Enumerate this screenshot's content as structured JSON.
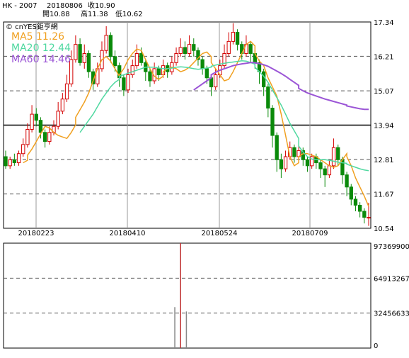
{
  "header": {
    "symbol": "HK - 2007",
    "date": "20180806",
    "close_label": "收10.90",
    "open_label": "開10.88",
    "high_label": "高11.38",
    "low_label": "低10.62"
  },
  "legend": {
    "brand": "© cnYES鉅亨網",
    "ma5": "MA5 11.26",
    "ma20": "MA20 12.44",
    "ma60": "MA60 14.46"
  },
  "colors": {
    "up": "#d40000",
    "down": "#0a8a0a",
    "ma5": "#f0a020",
    "ma20": "#4fd8a0",
    "ma60": "#9b55d6",
    "volume_up": "#c03030",
    "volume_down": "#888888"
  },
  "chart_data": [
    {
      "type": "candlestick",
      "title": "",
      "ylim": [
        10.54,
        17.34
      ],
      "y_ticks": [
        "17.34",
        "16.21",
        "15.07",
        "13.94",
        "12.81",
        "11.67",
        "10.54"
      ],
      "x_ticks": [
        "20180223",
        "20180410",
        "20180524",
        "20180709"
      ],
      "grid": true,
      "series": [
        {
          "name": "MA5",
          "values": [
            null,
            null,
            null,
            null,
            12.7,
            12.78,
            12.95,
            13.15,
            13.4,
            13.65,
            13.9,
            13.85,
            13.7,
            13.6,
            13.55,
            13.5,
            13.7,
            13.95,
            14.2,
            14.45,
            14.7,
            15.0,
            15.4,
            15.8,
            16.1,
            16.2,
            16.05,
            15.8,
            15.55,
            15.6,
            15.8,
            16.1,
            16.3,
            16.45,
            16.4,
            16.1,
            15.8,
            15.55,
            15.45,
            15.55,
            15.7,
            15.8,
            15.85,
            15.8,
            15.7,
            15.75,
            15.85,
            16.0,
            16.15,
            16.3,
            16.35,
            16.2,
            16.0,
            15.8,
            15.6,
            15.4,
            15.45,
            15.7,
            16.0,
            16.3,
            16.6,
            16.7,
            16.55,
            16.3,
            16.05,
            15.9,
            15.5,
            15.2,
            14.9,
            14.3,
            13.6,
            12.9,
            12.6,
            12.7,
            12.9,
            13.0,
            13.0,
            12.95,
            12.9,
            12.8,
            12.7,
            12.6,
            12.55,
            12.6,
            12.8,
            13.0,
            12.9,
            12.6,
            12.2,
            11.9,
            11.6,
            11.26
          ]
        },
        {
          "name": "MA20",
          "values": [
            null,
            null,
            null,
            null,
            null,
            null,
            null,
            null,
            null,
            null,
            null,
            null,
            null,
            null,
            null,
            null,
            null,
            null,
            null,
            13.7,
            13.9,
            14.1,
            14.3,
            14.55,
            14.8,
            15.0,
            15.2,
            15.35,
            15.45,
            15.55,
            15.6,
            15.65,
            15.7,
            15.75,
            15.8,
            15.85,
            15.85,
            15.85,
            15.82,
            15.8,
            15.8,
            15.8,
            15.82,
            15.85,
            15.86,
            15.85,
            15.83,
            15.8,
            15.78,
            15.8,
            15.82,
            15.85,
            15.88,
            15.92,
            15.95,
            15.98,
            16.0,
            16.02,
            16.04,
            16.06,
            16.05,
            16.0,
            15.95,
            15.85,
            15.7,
            15.55,
            15.35,
            15.1,
            14.85,
            14.6,
            14.3,
            14.0,
            13.75,
            13.5,
            13.25,
            13.05,
            12.9,
            12.82,
            12.8,
            12.8,
            12.8,
            12.78,
            12.75,
            12.72,
            12.7,
            12.68,
            12.65,
            12.6,
            12.55,
            12.5,
            12.46,
            12.44
          ]
        },
        {
          "name": "MA60",
          "values": [
            null,
            null,
            null,
            null,
            null,
            null,
            null,
            null,
            null,
            null,
            null,
            null,
            null,
            null,
            null,
            null,
            null,
            null,
            null,
            null,
            null,
            null,
            null,
            null,
            null,
            null,
            null,
            null,
            null,
            null,
            null,
            null,
            null,
            null,
            null,
            null,
            null,
            null,
            null,
            null,
            null,
            null,
            null,
            null,
            null,
            null,
            null,
            15.1,
            15.2,
            15.3,
            15.4,
            15.5,
            15.6,
            15.68,
            15.75,
            15.8,
            15.85,
            15.9,
            15.93,
            15.96,
            15.98,
            16.0,
            16.0,
            15.99,
            15.97,
            15.93,
            15.88,
            15.8,
            15.72,
            15.64,
            15.55,
            15.45,
            15.35,
            15.25,
            15.15,
            15.07,
            15.0,
            14.95,
            14.9,
            14.85,
            14.8,
            14.76,
            14.72,
            14.68,
            14.64,
            14.6,
            14.57,
            14.54,
            14.51,
            14.48,
            14.46,
            14.46
          ]
        }
      ],
      "candles": [
        [
          12.9,
          12.6,
          13.1,
          12.5
        ],
        [
          12.6,
          12.8,
          12.9,
          12.5
        ],
        [
          12.8,
          12.7,
          13.0,
          12.6
        ],
        [
          12.7,
          13.0,
          13.1,
          12.6
        ],
        [
          13.0,
          13.3,
          13.5,
          12.9
        ],
        [
          13.3,
          13.8,
          14.0,
          13.2
        ],
        [
          13.8,
          14.3,
          14.6,
          13.7
        ],
        [
          14.3,
          14.1,
          14.5,
          13.9
        ],
        [
          14.1,
          13.7,
          14.2,
          13.5
        ],
        [
          13.7,
          13.4,
          13.8,
          13.2
        ],
        [
          13.4,
          13.7,
          13.9,
          13.3
        ],
        [
          13.7,
          13.9,
          14.1,
          13.6
        ],
        [
          13.9,
          14.4,
          14.7,
          13.8
        ],
        [
          14.4,
          14.8,
          15.0,
          14.3
        ],
        [
          14.8,
          15.3,
          15.6,
          14.7
        ],
        [
          15.3,
          16.1,
          16.4,
          15.2
        ],
        [
          16.1,
          16.6,
          16.9,
          16.0
        ],
        [
          16.6,
          16.0,
          16.8,
          15.9
        ],
        [
          16.0,
          16.3,
          16.6,
          15.8
        ],
        [
          16.3,
          15.7,
          16.4,
          15.5
        ],
        [
          15.7,
          15.3,
          15.8,
          15.1
        ],
        [
          15.3,
          15.8,
          16.0,
          15.2
        ],
        [
          15.8,
          16.4,
          16.7,
          15.7
        ],
        [
          16.4,
          16.9,
          17.2,
          16.3
        ],
        [
          16.9,
          16.2,
          17.0,
          16.0
        ],
        [
          16.2,
          15.9,
          16.4,
          15.7
        ],
        [
          15.9,
          15.5,
          16.0,
          15.2
        ],
        [
          15.5,
          15.1,
          15.6,
          14.9
        ],
        [
          15.1,
          15.6,
          15.8,
          15.0
        ],
        [
          15.6,
          15.9,
          16.1,
          15.5
        ],
        [
          15.9,
          16.3,
          16.6,
          15.8
        ],
        [
          16.3,
          16.0,
          16.5,
          15.9
        ],
        [
          16.0,
          15.7,
          16.1,
          15.4
        ],
        [
          15.7,
          15.4,
          15.8,
          15.2
        ],
        [
          15.4,
          15.8,
          16.0,
          15.3
        ],
        [
          15.8,
          15.6,
          15.9,
          15.4
        ],
        [
          15.6,
          15.9,
          16.1,
          15.5
        ],
        [
          15.9,
          15.7,
          16.0,
          15.5
        ],
        [
          15.7,
          16.0,
          16.2,
          15.6
        ],
        [
          16.0,
          16.3,
          16.5,
          15.9
        ],
        [
          16.3,
          16.5,
          16.8,
          16.2
        ],
        [
          16.5,
          16.3,
          16.7,
          16.1
        ],
        [
          16.3,
          16.6,
          16.9,
          16.2
        ],
        [
          16.6,
          16.4,
          16.8,
          16.2
        ],
        [
          16.4,
          16.1,
          16.5,
          15.9
        ],
        [
          16.1,
          15.8,
          16.2,
          15.6
        ],
        [
          15.8,
          15.5,
          15.9,
          15.3
        ],
        [
          15.5,
          15.2,
          15.6,
          14.9
        ],
        [
          15.2,
          15.6,
          15.8,
          15.1
        ],
        [
          15.6,
          15.9,
          16.1,
          15.5
        ],
        [
          15.9,
          16.3,
          16.6,
          15.8
        ],
        [
          16.3,
          16.7,
          17.0,
          16.2
        ],
        [
          16.7,
          17.0,
          17.3,
          16.6
        ],
        [
          17.0,
          16.6,
          17.1,
          16.4
        ],
        [
          16.6,
          16.3,
          16.7,
          16.1
        ],
        [
          16.3,
          16.6,
          16.9,
          16.2
        ],
        [
          16.6,
          16.3,
          16.7,
          16.0
        ],
        [
          16.3,
          16.0,
          16.4,
          15.8
        ],
        [
          16.0,
          15.7,
          16.1,
          15.3
        ],
        [
          15.7,
          15.2,
          15.8,
          14.9
        ],
        [
          15.2,
          14.5,
          15.3,
          14.2
        ],
        [
          14.5,
          13.6,
          14.6,
          13.2
        ],
        [
          13.6,
          12.8,
          13.7,
          12.4
        ],
        [
          12.8,
          12.5,
          13.0,
          12.2
        ],
        [
          12.5,
          12.9,
          13.1,
          12.4
        ],
        [
          12.9,
          13.2,
          13.4,
          12.8
        ],
        [
          13.2,
          12.9,
          13.3,
          12.7
        ],
        [
          12.9,
          13.1,
          13.3,
          12.8
        ],
        [
          13.1,
          12.8,
          13.2,
          12.6
        ],
        [
          12.8,
          12.6,
          12.9,
          12.4
        ],
        [
          12.6,
          12.9,
          13.0,
          12.5
        ],
        [
          12.9,
          12.7,
          13.0,
          12.5
        ],
        [
          12.7,
          12.5,
          12.8,
          12.2
        ],
        [
          12.5,
          12.3,
          12.6,
          11.9
        ],
        [
          12.3,
          12.6,
          12.8,
          12.2
        ],
        [
          12.6,
          13.2,
          13.5,
          12.5
        ],
        [
          13.2,
          12.8,
          13.3,
          12.6
        ],
        [
          12.8,
          12.3,
          12.9,
          12.0
        ],
        [
          12.3,
          11.9,
          12.4,
          11.6
        ],
        [
          11.9,
          11.5,
          12.0,
          11.3
        ],
        [
          11.5,
          11.3,
          11.6,
          11.1
        ],
        [
          11.3,
          11.1,
          11.4,
          10.9
        ],
        [
          11.1,
          10.9,
          11.2,
          10.7
        ],
        [
          10.88,
          10.9,
          11.38,
          10.62
        ]
      ]
    },
    {
      "type": "bar",
      "title": "",
      "ylim": [
        0,
        97369900
      ],
      "y_ticks": [
        "97369900",
        "64913267",
        "32456633",
        "0"
      ],
      "grid": true,
      "volume_spikes": [
        {
          "candle_index": 39,
          "value": 38000000,
          "color": "down"
        },
        {
          "candle_index": 40,
          "value": 97369900,
          "color": "up"
        },
        {
          "candle_index": 41,
          "value": 34000000,
          "color": "down"
        }
      ]
    }
  ]
}
